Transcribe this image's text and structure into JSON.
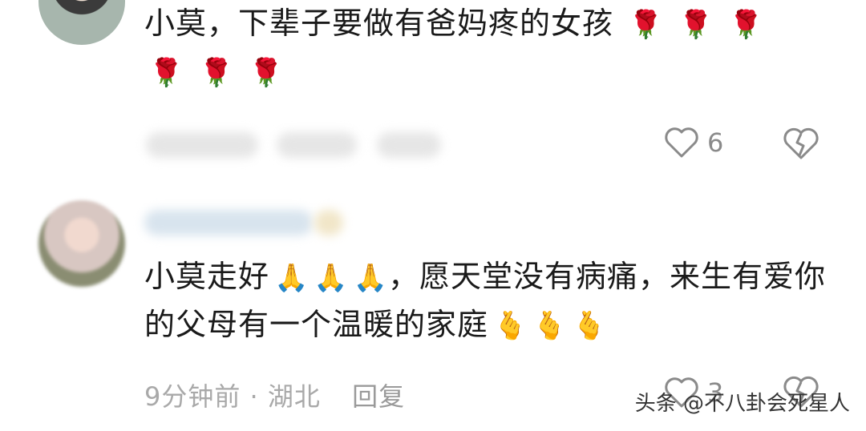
{
  "comments": [
    {
      "text": "小莫，下辈子要做有爸妈疼的女孩",
      "emojis": [
        "🌹",
        "🌹",
        "🌹",
        "🌹",
        "🌹",
        "🌹"
      ],
      "likes": "6"
    },
    {
      "text_part1": "小莫走好",
      "emojis_pray": [
        "🙏",
        "🙏",
        "🙏"
      ],
      "text_part2": "，愿天堂没有病痛，来生有爱你的父母有一个温暖的家庭",
      "emojis_heart": [
        "🫰",
        "🫰",
        "🫰"
      ],
      "meta_time": "9分钟前",
      "meta_dot": "·",
      "meta_location": "湖北",
      "reply_label": "回复",
      "likes": "3"
    }
  ],
  "watermark": "头条 @不八卦会死星人",
  "icons": {
    "like": "heart-outline-icon",
    "dislike": "broken-heart-icon"
  }
}
